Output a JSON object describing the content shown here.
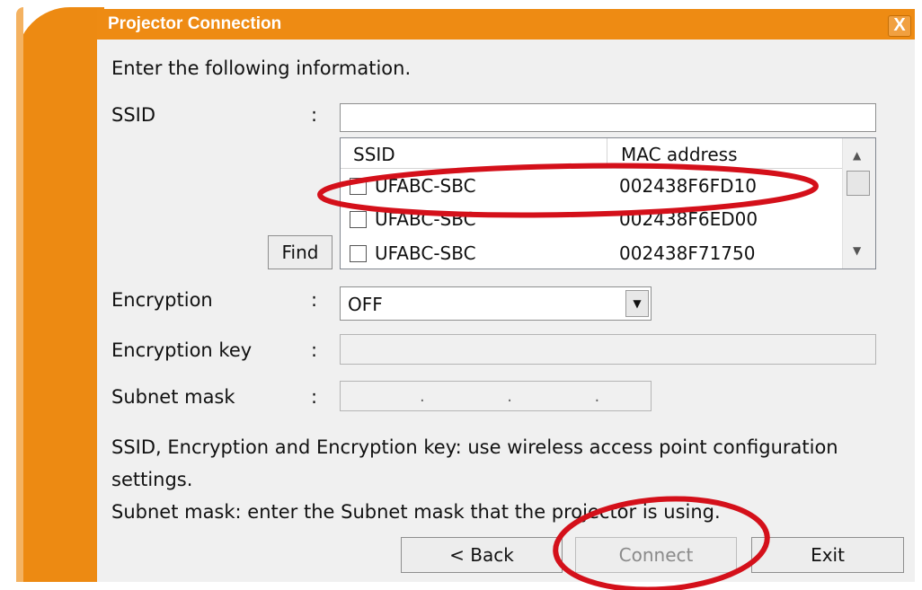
{
  "window": {
    "title": "Projector Connection",
    "close_label": "X",
    "accent_color": "#ee8b13"
  },
  "instructions": "Enter the following information.",
  "ssid": {
    "label": "SSID",
    "colon": ":",
    "value": "",
    "find_label": "Find",
    "list": {
      "columns": [
        "SSID",
        "MAC address"
      ],
      "rows": [
        {
          "ssid": "UFABC-SBC",
          "mac": "002438F6FD10",
          "checked": false
        },
        {
          "ssid": "UFABC-SBC",
          "mac": "002438F6ED00",
          "checked": false
        },
        {
          "ssid": "UFABC-SBC",
          "mac": "002438F71750",
          "checked": false
        }
      ]
    }
  },
  "encryption": {
    "label": "Encryption",
    "colon": ":",
    "value": "OFF"
  },
  "encryption_key": {
    "label": "Encryption key",
    "colon": ":",
    "value": ""
  },
  "subnet_mask": {
    "label": "Subnet mask",
    "colon": ":",
    "dots": ".                .                ."
  },
  "notes": {
    "line1": "SSID, Encryption and Encryption key: use wireless access point configuration",
    "line2": "settings.",
    "line3": "Subnet mask: enter the Subnet mask that the projector is using."
  },
  "buttons": {
    "back": "< Back",
    "connect": "Connect",
    "exit": "Exit"
  },
  "annotation_color": "#d4101a"
}
